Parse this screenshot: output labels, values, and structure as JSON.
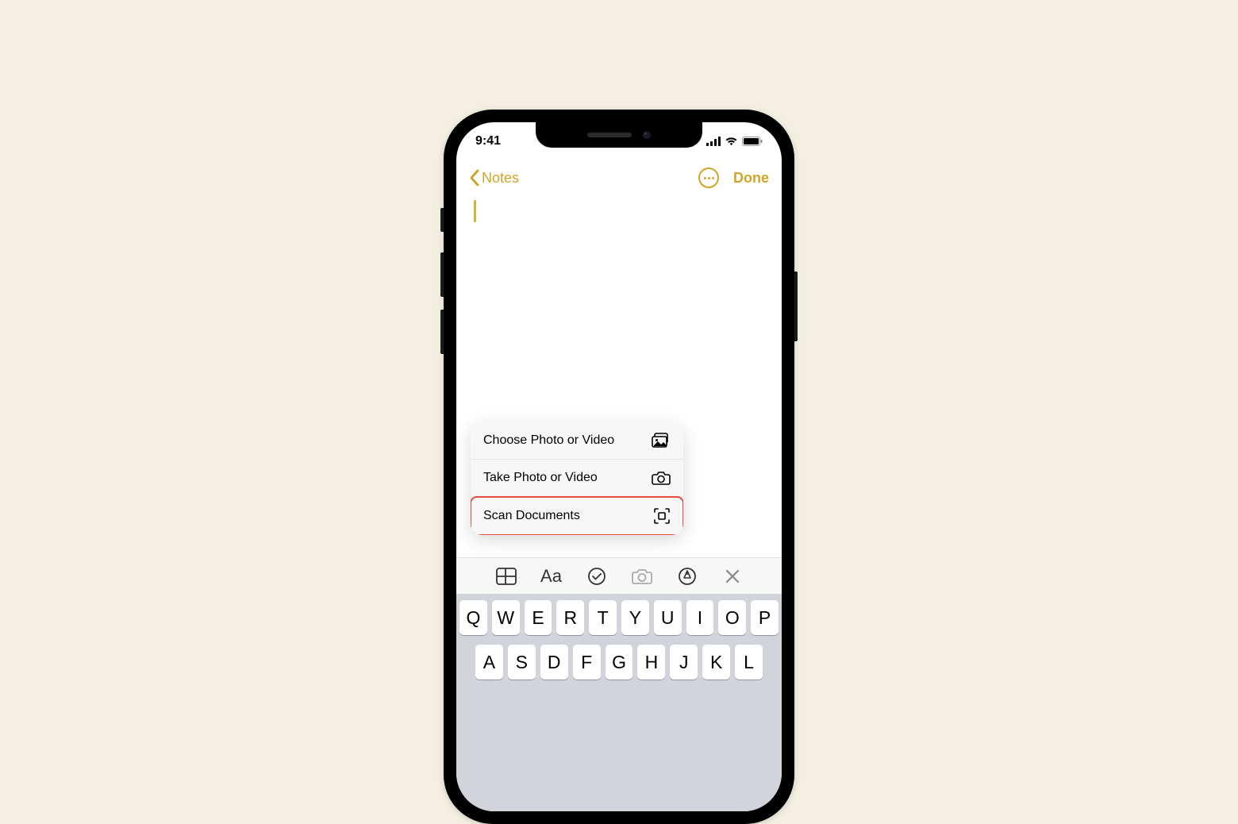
{
  "status": {
    "time": "9:41"
  },
  "nav": {
    "back_label": "Notes",
    "done_label": "Done"
  },
  "menu": {
    "items": [
      {
        "label": "Choose Photo or Video",
        "icon": "photo-stack-icon",
        "highlight": false
      },
      {
        "label": "Take Photo or Video",
        "icon": "camera-icon",
        "highlight": false
      },
      {
        "label": "Scan Documents",
        "icon": "scan-icon",
        "highlight": true
      }
    ]
  },
  "toolbar": {
    "tools": [
      "table",
      "text-format",
      "checklist",
      "camera",
      "markup",
      "close"
    ]
  },
  "keyboard": {
    "row1": [
      "Q",
      "W",
      "E",
      "R",
      "T",
      "Y",
      "U",
      "I",
      "O",
      "P"
    ],
    "row2": [
      "A",
      "S",
      "D",
      "F",
      "G",
      "H",
      "J",
      "K",
      "L"
    ]
  }
}
